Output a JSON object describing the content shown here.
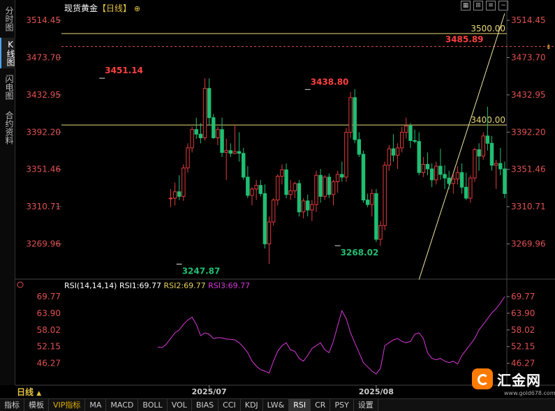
{
  "side_tabs": [
    "分时图",
    "K线图",
    "闪电图",
    "合约资料"
  ],
  "title": {
    "name": "现货黄金",
    "period": "【日线】",
    "icon": "circle-plus-icon"
  },
  "toolbar_icons": [
    "grid-icon",
    "zoom-icon",
    "list-icon",
    "minus-icon"
  ],
  "period_label": "日线",
  "period_arrow": "▲",
  "bottom_tabs": [
    "指标",
    "模板",
    "VIP指标",
    "MA",
    "MACD",
    "BOLL",
    "VOL",
    "BIAS",
    "CCI",
    "KDJ",
    "LW&",
    "RSI",
    "CR",
    "PSY",
    "设置"
  ],
  "active_bottom_tab": "RSI",
  "logo": {
    "text": "汇金网",
    "url": "www.gold678.com"
  },
  "rsi_legend": {
    "prefix": "RSI(14,14,14)",
    "rsi1": "RSI1:69.77",
    "rsi2": "RSI2:69.77",
    "rsi3": "RSI3:69.77"
  },
  "colors": {
    "up": "#e03c3c",
    "down": "#1fbf73",
    "price_axis": "#e05050",
    "hline": "#e8d878",
    "rsi": "#d838d8",
    "rsi_axis": "#e05050"
  },
  "chart_data": {
    "type": "candlestick",
    "title": "现货黄金【日线】",
    "price_axis_ticks": [
      3514.45,
      3473.7,
      3432.95,
      3392.2,
      3351.46,
      3310.71,
      3269.96
    ],
    "price_range": [
      3233,
      3526
    ],
    "x_labels": [
      {
        "index": 34,
        "label": "2025/07"
      },
      {
        "index": 73,
        "label": "2025/08"
      }
    ],
    "annotations": [
      {
        "index": 9,
        "price": 3451.14,
        "label": "3451.14",
        "kind": "high"
      },
      {
        "index": 57,
        "price": 3438.8,
        "label": "3438.80",
        "kind": "high"
      },
      {
        "index": 27,
        "price": 3247.87,
        "label": "3247.87",
        "kind": "low"
      },
      {
        "index": 64,
        "price": 3268.02,
        "label": "3268.02",
        "kind": "low"
      },
      {
        "index": 100,
        "price": 3485.89,
        "label": "3485.89",
        "kind": "current"
      }
    ],
    "horizontal_lines": [
      {
        "price": 3500.0,
        "label": "3500.00"
      },
      {
        "price": 3400.0,
        "label": "3400.00"
      }
    ],
    "current_price_line": 3485.89,
    "trendline": {
      "from": {
        "index": 83,
        "price": 3231
      },
      "to": {
        "index": 103,
        "price": 3522
      }
    },
    "candles": [
      [
        3320,
        3330,
        3310,
        3320
      ],
      [
        3320,
        3337,
        3312,
        3327
      ],
      [
        3327,
        3345,
        3318,
        3322
      ],
      [
        3322,
        3357,
        3317,
        3353
      ],
      [
        3353,
        3380,
        3348,
        3375
      ],
      [
        3375,
        3398,
        3370,
        3395
      ],
      [
        3395,
        3408,
        3385,
        3390
      ],
      [
        3390,
        3402,
        3380,
        3386
      ],
      [
        3386,
        3451,
        3383,
        3440
      ],
      [
        3440,
        3451,
        3400,
        3408
      ],
      [
        3408,
        3412,
        3385,
        3386
      ],
      [
        3386,
        3398,
        3378,
        3395
      ],
      [
        3395,
        3408,
        3365,
        3370
      ],
      [
        3370,
        3385,
        3340,
        3372
      ],
      [
        3372,
        3380,
        3365,
        3369
      ],
      [
        3369,
        3400,
        3368,
        3371
      ],
      [
        3371,
        3392,
        3360,
        3369
      ],
      [
        3369,
        3375,
        3340,
        3343
      ],
      [
        3343,
        3355,
        3320,
        3323
      ],
      [
        3323,
        3332,
        3312,
        3330
      ],
      [
        3330,
        3340,
        3318,
        3334
      ],
      [
        3334,
        3340,
        3322,
        3325
      ],
      [
        3325,
        3335,
        3265,
        3270
      ],
      [
        3270,
        3300,
        3248,
        3294
      ],
      [
        3294,
        3320,
        3290,
        3318
      ],
      [
        3318,
        3346,
        3312,
        3344
      ],
      [
        3344,
        3357,
        3335,
        3351
      ],
      [
        3351,
        3358,
        3320,
        3324
      ],
      [
        3324,
        3340,
        3318,
        3328
      ],
      [
        3328,
        3338,
        3320,
        3336
      ],
      [
        3336,
        3340,
        3300,
        3305
      ],
      [
        3305,
        3320,
        3298,
        3317
      ],
      [
        3317,
        3324,
        3300,
        3307
      ],
      [
        3307,
        3318,
        3295,
        3313
      ],
      [
        3313,
        3350,
        3305,
        3345
      ],
      [
        3345,
        3352,
        3315,
        3322
      ],
      [
        3322,
        3345,
        3318,
        3343
      ],
      [
        3343,
        3347,
        3320,
        3324
      ],
      [
        3324,
        3340,
        3312,
        3338
      ],
      [
        3338,
        3350,
        3326,
        3346
      ],
      [
        3346,
        3360,
        3338,
        3343
      ],
      [
        3343,
        3397,
        3338,
        3392
      ],
      [
        3392,
        3436,
        3386,
        3430
      ],
      [
        3430,
        3439,
        3380,
        3384
      ],
      [
        3384,
        3392,
        3365,
        3368
      ],
      [
        3368,
        3372,
        3315,
        3318
      ],
      [
        3318,
        3325,
        3310,
        3313
      ],
      [
        3313,
        3330,
        3300,
        3325
      ],
      [
        3325,
        3330,
        3272,
        3275
      ],
      [
        3275,
        3295,
        3268,
        3290
      ],
      [
        3290,
        3360,
        3285,
        3356
      ],
      [
        3356,
        3378,
        3350,
        3374
      ],
      [
        3374,
        3390,
        3360,
        3367
      ],
      [
        3367,
        3380,
        3352,
        3375
      ],
      [
        3375,
        3398,
        3370,
        3392
      ],
      [
        3392,
        3408,
        3385,
        3399
      ],
      [
        3399,
        3402,
        3375,
        3383
      ],
      [
        3383,
        3395,
        3380,
        3382
      ],
      [
        3382,
        3392,
        3345,
        3348
      ],
      [
        3348,
        3365,
        3343,
        3357
      ],
      [
        3357,
        3370,
        3345,
        3352
      ],
      [
        3352,
        3358,
        3332,
        3340
      ],
      [
        3340,
        3360,
        3335,
        3355
      ],
      [
        3355,
        3374,
        3340,
        3346
      ],
      [
        3346,
        3356,
        3330,
        3342
      ],
      [
        3342,
        3350,
        3330,
        3336
      ],
      [
        3336,
        3347,
        3325,
        3341
      ],
      [
        3341,
        3355,
        3335,
        3348
      ],
      [
        3348,
        3358,
        3325,
        3332
      ],
      [
        3332,
        3348,
        3318,
        3320
      ],
      [
        3320,
        3345,
        3315,
        3342
      ],
      [
        3342,
        3375,
        3338,
        3373
      ],
      [
        3373,
        3380,
        3350,
        3366
      ],
      [
        3366,
        3392,
        3362,
        3388
      ],
      [
        3388,
        3420,
        3372,
        3380
      ],
      [
        3380,
        3388,
        3350,
        3356
      ],
      [
        3356,
        3362,
        3330,
        3358
      ],
      [
        3358,
        3375,
        3345,
        3352
      ],
      [
        3352,
        3360,
        3320,
        3325
      ]
    ],
    "rsi": {
      "name": "RSI1",
      "axis_ticks": [
        69.77,
        63.9,
        58.02,
        52.15,
        46.27
      ],
      "range": [
        41.5,
        72
      ],
      "values": [
        52,
        51.8,
        53,
        55,
        57,
        58,
        60,
        61.5,
        62.5,
        60,
        56,
        57,
        56.5,
        55,
        55.3,
        55.2,
        54.8,
        54.7,
        54.5,
        53.5,
        52,
        50,
        47,
        45.3,
        44,
        43.5,
        42.8,
        47,
        50.5,
        52.5,
        53.5,
        51,
        50.5,
        48,
        47,
        49,
        51.5,
        52.5,
        53.5,
        51,
        50,
        54,
        59.5,
        64.8,
        62,
        57,
        53.5,
        50,
        46.5,
        45,
        43.5,
        42.5,
        44.5,
        52.5,
        53.5,
        54.5,
        55,
        54,
        53.5,
        54,
        56.5,
        57,
        55,
        50,
        48,
        47.5,
        48,
        47,
        46.5,
        47,
        46,
        49,
        51,
        53,
        55,
        58,
        60,
        62,
        64,
        65.5,
        67.5,
        69.77
      ]
    }
  }
}
